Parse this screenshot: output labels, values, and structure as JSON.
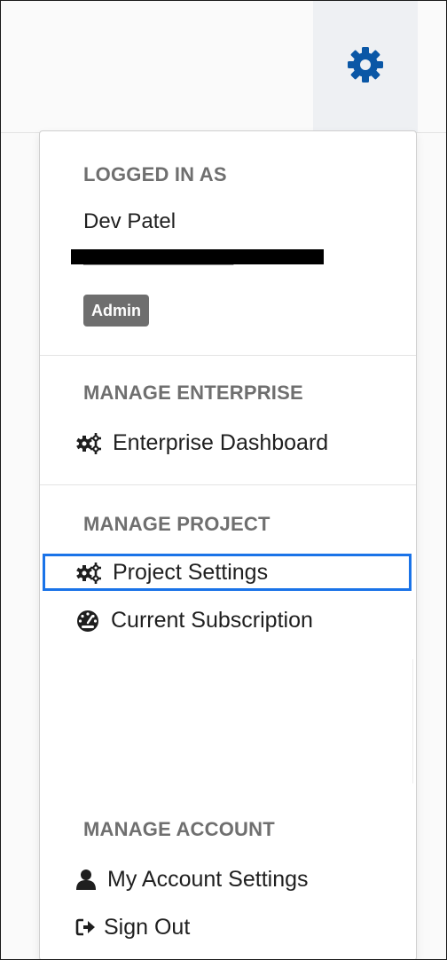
{
  "header": {
    "settings_icon": "gear-icon"
  },
  "menu": {
    "logged_in": {
      "heading": "LOGGED IN AS",
      "name": "Dev Patel",
      "badge": "Admin"
    },
    "enterprise": {
      "heading": "MANAGE ENTERPRISE",
      "items": [
        {
          "label": "Enterprise Dashboard",
          "icon": "cogs-icon"
        }
      ]
    },
    "project": {
      "heading": "MANAGE PROJECT",
      "items": [
        {
          "label": "Project Settings",
          "icon": "cogs-icon",
          "highlighted": true
        },
        {
          "label": "Current Subscription",
          "icon": "tachometer-icon"
        }
      ]
    },
    "account": {
      "heading": "MANAGE ACCOUNT",
      "items": [
        {
          "label": "My Account Settings",
          "icon": "user-icon"
        },
        {
          "label": "Sign Out",
          "icon": "sign-out-icon"
        }
      ]
    }
  },
  "colors": {
    "highlight_border": "#1a73e8",
    "gear_icon": "#0a57a6",
    "badge_bg": "#6e6e6e",
    "heading_text": "#6f6f6f"
  }
}
